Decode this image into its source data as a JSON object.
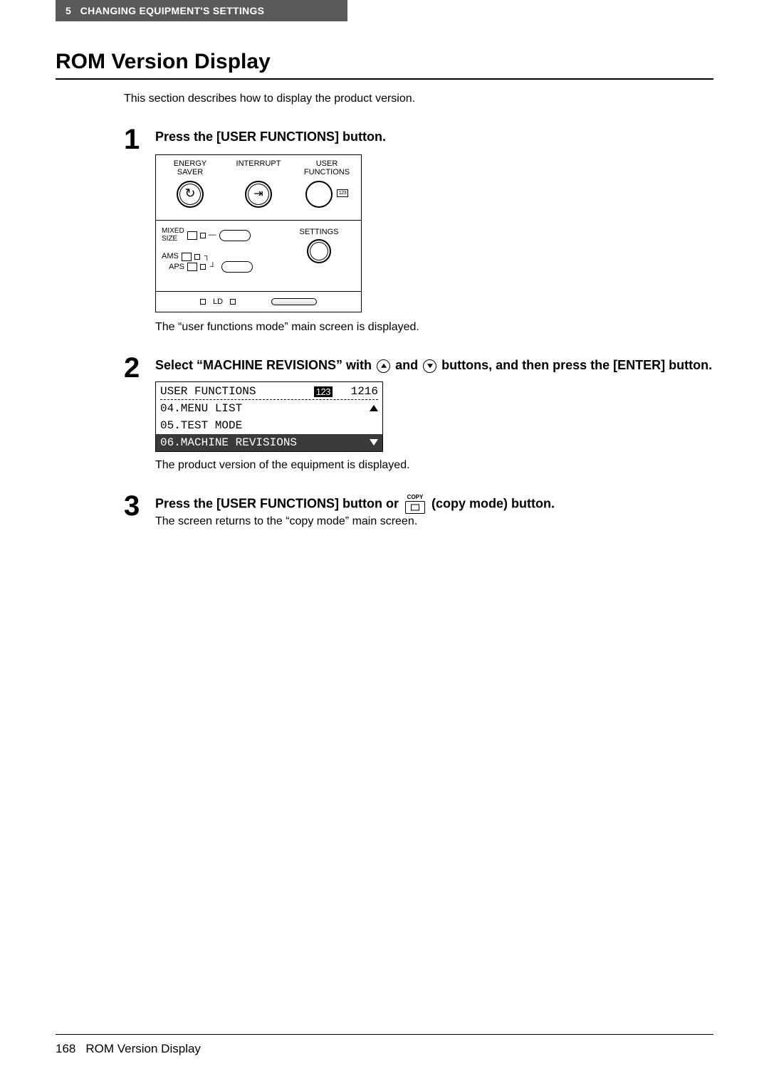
{
  "header": {
    "chapter_num": "5",
    "chapter_title": "CHANGING EQUIPMENT'S SETTINGS"
  },
  "title": "ROM Version Display",
  "intro": "This section describes how to display the product version.",
  "steps": {
    "s1": {
      "num": "1",
      "head": "Press the [USER FUNCTIONS] button.",
      "note": "The “user functions mode” main screen is displayed.",
      "panel": {
        "energy": "ENERGY\nSAVER",
        "interrupt": "INTERRUPT",
        "user_functions": "USER\nFUNCTIONS",
        "uf_badge": "123",
        "mixed": "MIXED\nSIZE",
        "ams": "AMS",
        "aps": "APS",
        "settings": "SETTINGS",
        "ld": "LD"
      }
    },
    "s2": {
      "num": "2",
      "head_a": "Select “MACHINE REVISIONS” with ",
      "head_b": " and ",
      "head_c": " buttons, and then press the [ENTER] button.",
      "note": "The product version of the equipment is displayed.",
      "lcd": {
        "title": "USER FUNCTIONS",
        "badge": "123",
        "count": "1216",
        "rows": [
          {
            "text": "04.MENU LIST",
            "selected": false,
            "arrow": "up"
          },
          {
            "text": "05.TEST MODE",
            "selected": false,
            "arrow": ""
          },
          {
            "text": "06.MACHINE REVISIONS",
            "selected": true,
            "arrow": "down"
          }
        ]
      }
    },
    "s3": {
      "num": "3",
      "head_a": "Press the [USER FUNCTIONS] button or ",
      "head_b": " (copy mode) button.",
      "copy_label": "COPY",
      "note": "The screen returns to the “copy mode” main screen."
    }
  },
  "footer": {
    "page": "168",
    "title": "ROM Version Display"
  }
}
